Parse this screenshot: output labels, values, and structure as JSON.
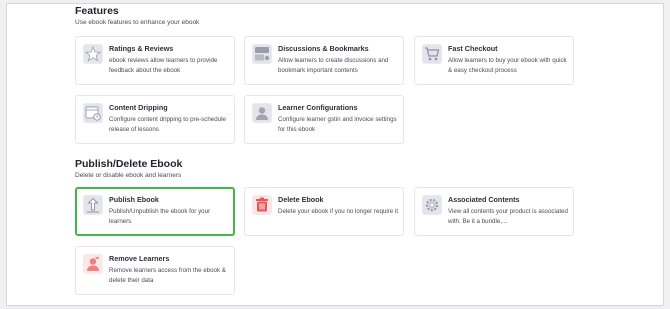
{
  "features": {
    "title": "Features",
    "subtitle": "Use ebook features to enhance your ebook",
    "cards": [
      {
        "title": "Ratings & Reviews",
        "description": "ebook reviews allow learners to provide feedback about the ebook",
        "icon": "star-icon"
      },
      {
        "title": "Discussions & Bookmarks",
        "description": "Allow learners to create discussions and bookmark important contents",
        "icon": "discussion-icon"
      },
      {
        "title": "Fast Checkout",
        "description": "Allow learners to buy your ebook with quick & easy checkout process",
        "icon": "cart-icon"
      },
      {
        "title": "Content Dripping",
        "description": "Configure content dripping to pre-schedule release of lessons",
        "icon": "calendar-clock-icon"
      },
      {
        "title": "Learner Configurations",
        "description": "Configure learner gstin and invoice settings for this ebook",
        "icon": "learner-icon"
      }
    ]
  },
  "publish": {
    "title": "Publish/Delete Ebook",
    "subtitle": "Delete or disable ebook and learners",
    "cards": [
      {
        "title": "Publish Ebook",
        "description": "Publish/Unpublish the ebook for your learners",
        "icon": "publish-upload-icon"
      },
      {
        "title": "Delete Ebook",
        "description": "Delete your ebook if you no longer require it",
        "icon": "trash-icon"
      },
      {
        "title": "Associated Contents",
        "description": "View all contents your product is associated with. Be it a bundle,...",
        "icon": "gear-icon"
      },
      {
        "title": "Remove Learners",
        "description": "Remove learners access from the ebook & delete their data",
        "icon": "remove-user-icon"
      }
    ]
  },
  "colors": {
    "highlight_border": "#43b649",
    "icon_background": "#e9e9ef",
    "delete_accent": "#e8585b",
    "remove_accent": "#f07f7f"
  }
}
